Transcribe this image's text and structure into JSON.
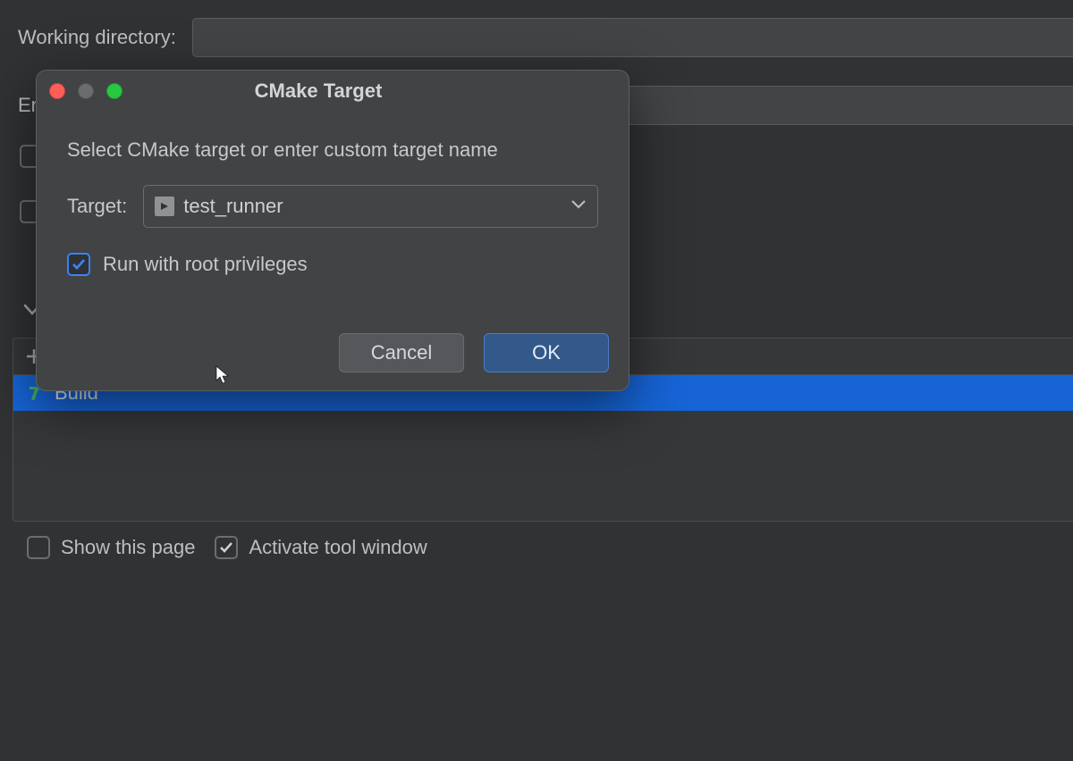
{
  "background": {
    "working_directory_label": "Working directory:",
    "working_directory_value": "",
    "environment_label": "Environment variables:",
    "environment_value": "",
    "list_selected_item": "Build",
    "show_this_page_label": "Show this page",
    "show_this_page_checked": false,
    "activate_tool_window_label": "Activate tool window",
    "activate_tool_window_checked": true
  },
  "dialog": {
    "title": "CMake Target",
    "message": "Select CMake target or enter custom target name",
    "target_label": "Target:",
    "target_value": "test_runner",
    "root_checkbox_label": "Run with root privileges",
    "root_checkbox_checked": true,
    "cancel_label": "Cancel",
    "ok_label": "OK"
  }
}
